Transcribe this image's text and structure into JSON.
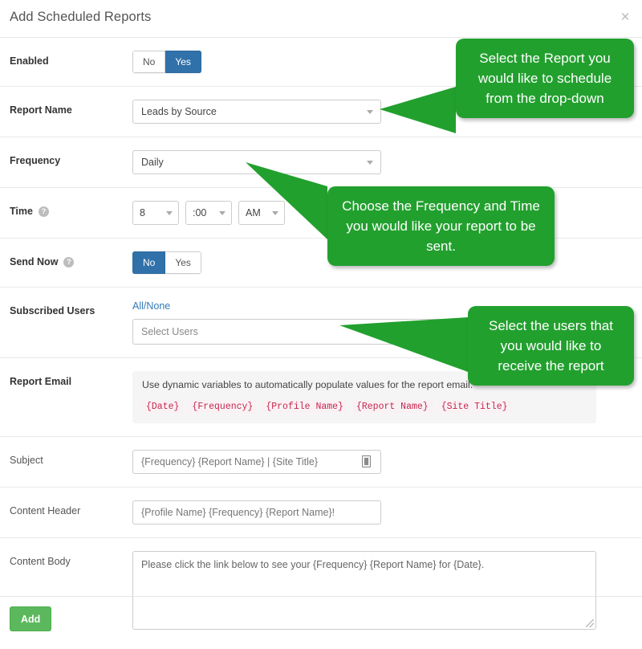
{
  "header": {
    "title": "Add Scheduled Reports",
    "close_label": "×"
  },
  "form": {
    "enabled": {
      "label": "Enabled",
      "options": [
        "No",
        "Yes"
      ],
      "selected": "Yes"
    },
    "report_name": {
      "label": "Report Name",
      "value": "Leads by Source"
    },
    "frequency": {
      "label": "Frequency",
      "value": "Daily"
    },
    "time": {
      "label": "Time",
      "help": "?",
      "hour": "8",
      "minute": ":00",
      "meridiem": "AM"
    },
    "send_now": {
      "label": "Send Now",
      "help": "?",
      "options": [
        "No",
        "Yes"
      ],
      "selected": "No"
    },
    "subscribed_users": {
      "label": "Subscribed Users",
      "all_none_link": "All/None",
      "placeholder": "Select Users"
    },
    "report_email": {
      "label": "Report Email",
      "description": "Use dynamic variables to automatically populate values for the report email.",
      "variables": [
        "{Date}",
        "{Frequency}",
        "{Profile Name}",
        "{Report Name}",
        "{Site Title}"
      ]
    },
    "subject": {
      "label": "Subject",
      "value": "{Frequency} {Report Name} | {Site Title}"
    },
    "content_header": {
      "label": "Content Header",
      "value": "{Profile Name} {Frequency} {Report Name}!"
    },
    "content_body": {
      "label": "Content Body",
      "value": "Please click the link below to see your {Frequency} {Report Name} for {Date}."
    }
  },
  "footer": {
    "add_label": "Add"
  },
  "callouts": [
    {
      "id": "report",
      "text": "Select the Report you would like to schedule from the drop-down"
    },
    {
      "id": "frequency",
      "text": "Choose the Frequency and Time you would like your report to be sent."
    },
    {
      "id": "users",
      "text": "Select the users that you would like to receive the report"
    }
  ],
  "colors": {
    "callout_green": "#22a02e",
    "toggle_blue": "#3071a9",
    "add_green": "#5cb85c",
    "link_blue": "#337ab7",
    "code_pink": "#c7254e"
  }
}
